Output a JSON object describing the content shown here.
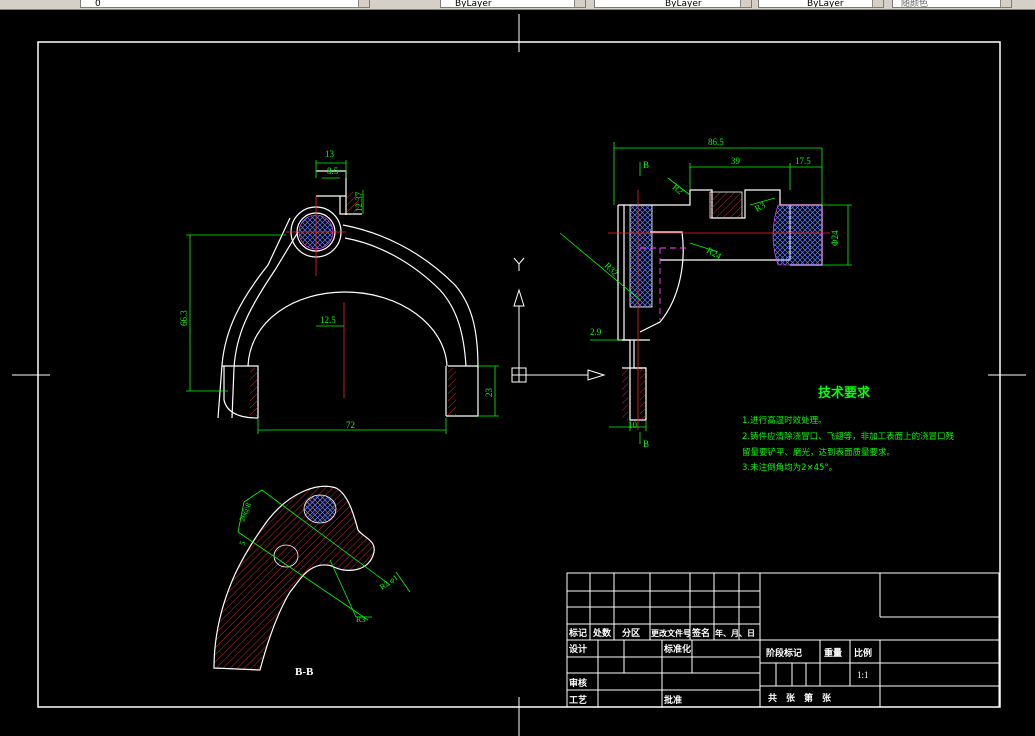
{
  "toolbar": {
    "layer_value": "0",
    "color_value": "ByLayer",
    "linetype_value": "ByLayer",
    "lineweight_value": "ByLayer",
    "plotstyle_value": "随颜色"
  },
  "drawing": {
    "front_view": {
      "dim_13": "13",
      "dim_8_5": "8.5",
      "dim_12_37": "12.37",
      "dim_66_3": "66.3",
      "dim_12_5": "12.5",
      "dim_72": "72",
      "dim_23": "23"
    },
    "side_view": {
      "dim_86_5": "86.5",
      "dim_39": "39",
      "dim_17_5": "17.5",
      "dim_phi24": "Φ24",
      "dim_2_9": "2.9",
      "dim_10": "10",
      "section_b_top": "B",
      "section_b_bottom": "B",
      "radius_r2": "R2",
      "radius_r3": "R3",
      "radius_r24": "R24",
      "radius_r32": "R32"
    },
    "ucs": {
      "y_label": "Y"
    },
    "section_view": {
      "title": "B-B",
      "dim_a": "20@8",
      "dim_b": "5",
      "dim_c": "R2 φ1",
      "dim_d": "R3"
    },
    "tech_req": {
      "title": "技术要求",
      "line1": "1.进行高温时效处理。",
      "line2": "2.铸件应清除浇冒口、飞翅等，非加工表面上的浇冒口残",
      "line3": "留量要铲平、磨光，达到表面质量要求。",
      "line4": "3.未注倒角均为2×45°。"
    },
    "title_block": {
      "mark": "标记",
      "count": "处数",
      "zone": "分区",
      "doc_no": "更改文件号",
      "signature": "签名",
      "date": "年、月、日",
      "design": "设计",
      "standardize": "标准化",
      "stage_mark": "阶段标记",
      "weight": "重量",
      "scale_label": "比例",
      "scale_value": "1:1",
      "review": "审核",
      "process": "工艺",
      "approve": "批准",
      "sheets": "共　张　第　张"
    }
  }
}
